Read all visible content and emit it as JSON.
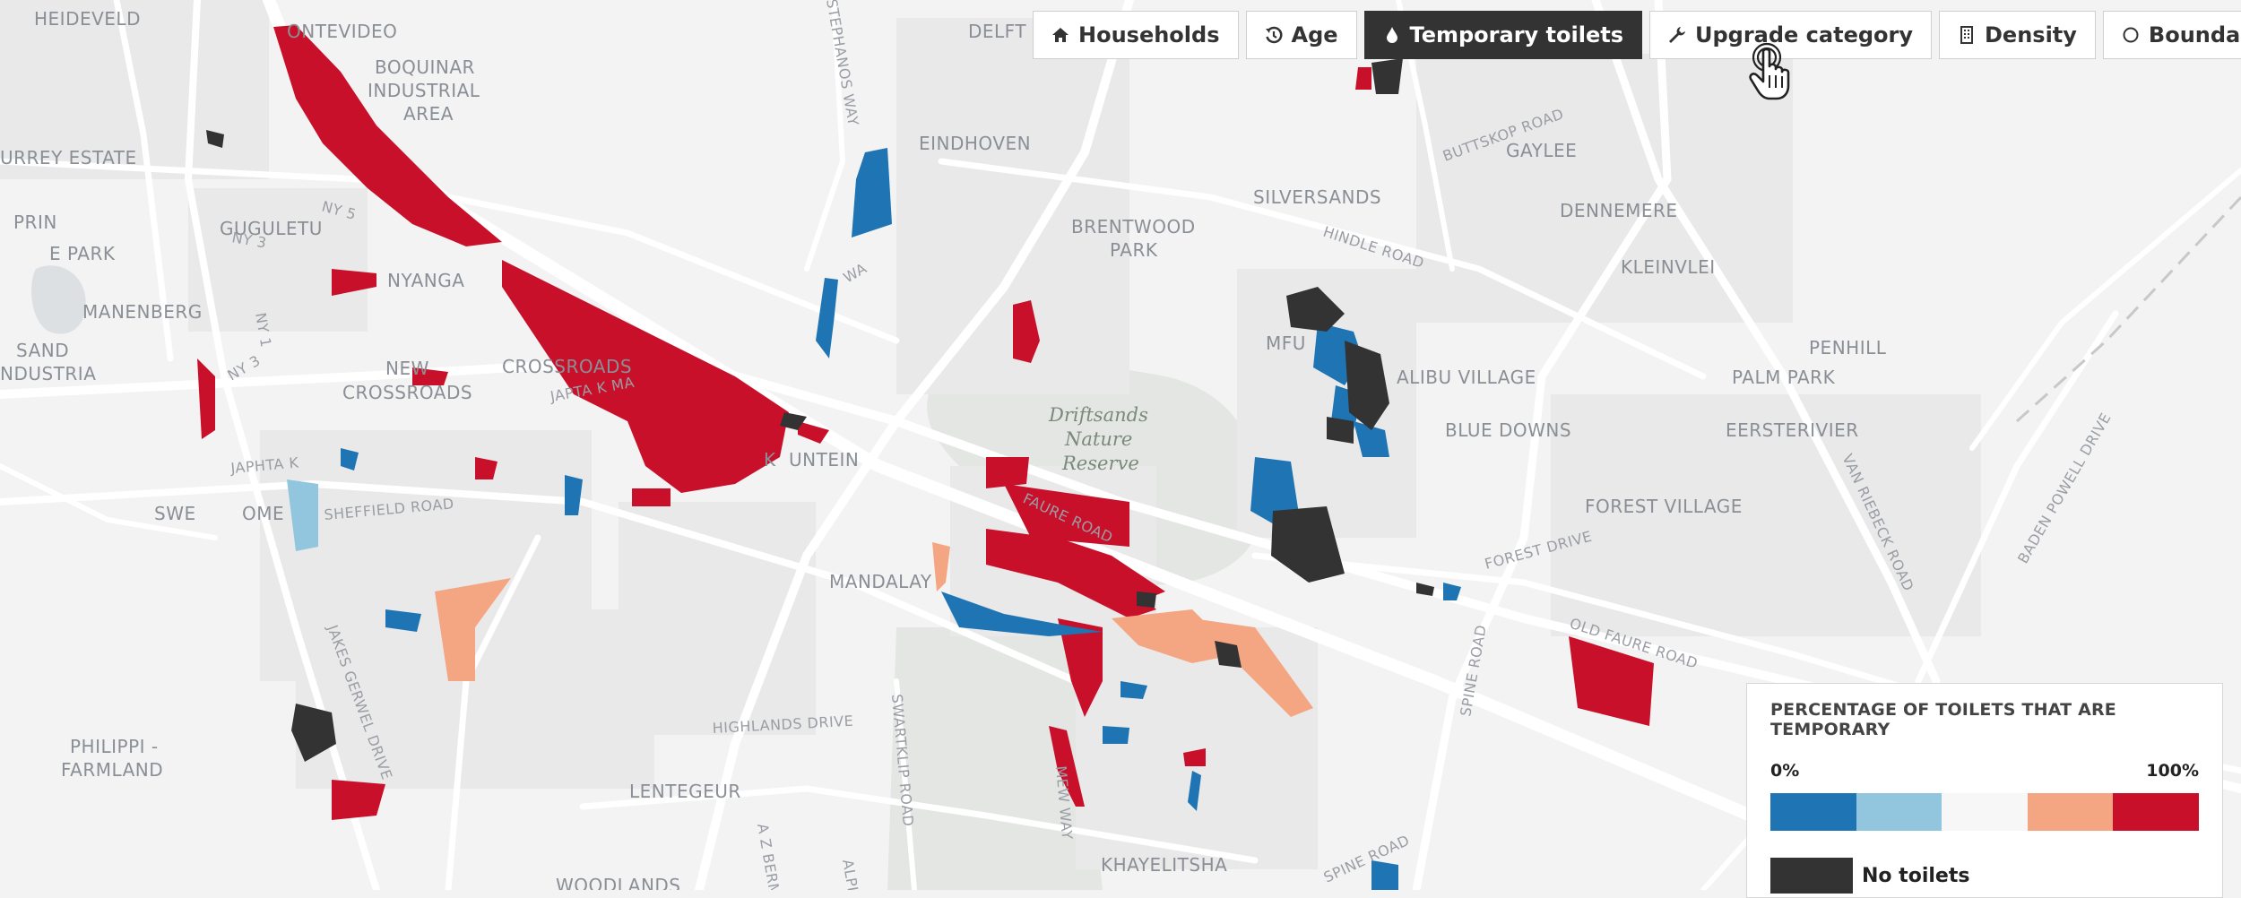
{
  "toolbar": {
    "buttons": [
      {
        "label": "Households",
        "icon": "home-icon",
        "active": false
      },
      {
        "label": "Age",
        "icon": "history-icon",
        "active": false
      },
      {
        "label": "Temporary toilets",
        "icon": "droplet-icon",
        "active": true
      },
      {
        "label": "Upgrade category",
        "icon": "wrench-icon",
        "active": false
      },
      {
        "label": "Density",
        "icon": "building-icon",
        "active": false
      },
      {
        "label": "Boundary",
        "icon": "circle-icon",
        "active": false
      }
    ]
  },
  "map": {
    "places": [
      "HEIDEVELD",
      "ONTEVIDEO",
      "BOQUINAR",
      "INDUSTRIAL",
      "AREA",
      "DELFT",
      "URREY ESTATE",
      "EINDHOVEN",
      "GAYLEE",
      "SILVERSANDS",
      "DENNEMERE",
      "BRENTWOOD",
      "PARK",
      "KLEINVLEI",
      "PRIN",
      "GUGULETU",
      "E PARK",
      "NYANGA",
      "MANENBERG",
      "MFU",
      "PENHILL",
      "SAND",
      "NDUSTRIA",
      "NEW",
      "CROSSROADS",
      "CROSSROADS",
      "ALIBU VILLAGE",
      "PALM PARK",
      "BLUE DOWNS",
      "EERSTERIVIER",
      "K",
      "UNTEIN",
      "SWE",
      "OME",
      "FOREST VILLAGE",
      "MANDALAY",
      "PHILIPPI -",
      "FARMLAND",
      "LENTEGEUR",
      "KHAYELITSHA",
      "WOODLANDS"
    ],
    "roads": [
      "BUTTSKOP ROAD",
      "HINDLE ROAD",
      "NY 5",
      "NY 3",
      "NY 1",
      "NY 3",
      "JAPTA K MA",
      "JAPHTA K",
      "SHEFFIELD ROAD",
      "FAURE ROAD",
      "FOREST DRIVE",
      "VAN RIEBECK ROAD",
      "BADEN POWELL DRIVE",
      "OLD FAURE ROAD",
      "SPINE ROAD",
      "HIGHLANDS DRIVE",
      "SWARTKLIP ROAD",
      "JAKES GERWEL DRIVE",
      "A Z BERMAN",
      "MEW WAY",
      "SPINE ROAD",
      "ALPINE",
      "STEPHANOS WAY",
      "WA"
    ],
    "reserve": [
      "Driftsands",
      "Nature",
      "Reserve"
    ],
    "colors": {
      "bin1": "#1f74b4",
      "bin2": "#92c5de",
      "bin3": "#f7f7f7",
      "bin4": "#f4a582",
      "bin5": "#c9102b",
      "no_toilets": "#333333"
    }
  },
  "legend": {
    "title": "PERCENTAGE OF TOILETS THAT ARE TEMPORARY",
    "min_label": "0%",
    "max_label": "100%",
    "ramp": [
      "#1f74b4",
      "#92c5de",
      "#f7f7f7",
      "#f4a582",
      "#c9102b"
    ],
    "no_data_label": "No toilets",
    "no_data_color": "#333333"
  }
}
